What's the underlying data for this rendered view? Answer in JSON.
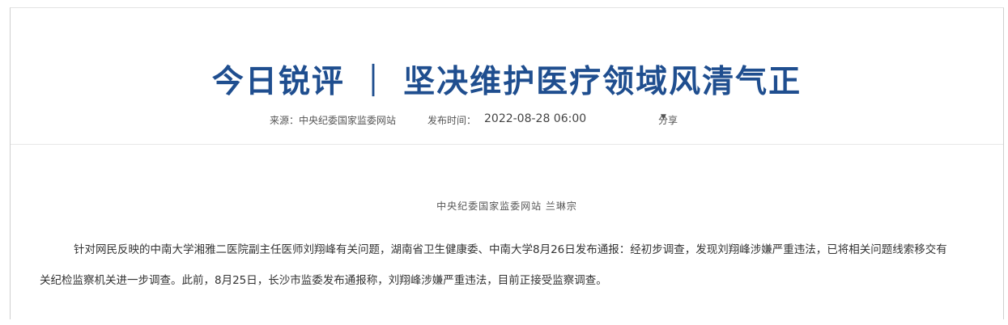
{
  "article": {
    "title": "今日锐评 ｜ 坚决维护医疗领域风清气正",
    "meta": {
      "source": "来源：中央纪委国家监委网站",
      "time_label": "发布时间：",
      "time_value": "2022-08-28 06:00",
      "share_label": "分享",
      "share_icon": "caret-down-icon"
    },
    "byline": "中央纪委国家监委网站 兰琳宗",
    "body": "针对网民反映的中南大学湘雅二医院副主任医师刘翔峰有关问题，湖南省卫生健康委、中南大学8月26日发布通报：经初步调查，发现刘翔峰涉嫌严重违法，已将相关问题线索移交有关纪检监察机关进一步调查。此前，8月25日，长沙市监委发布通报称，刘翔峰涉嫌严重违法，目前正接受监察调查。"
  },
  "colors": {
    "title": "#1f4e8f",
    "text": "#333333",
    "meta": "#555555"
  }
}
